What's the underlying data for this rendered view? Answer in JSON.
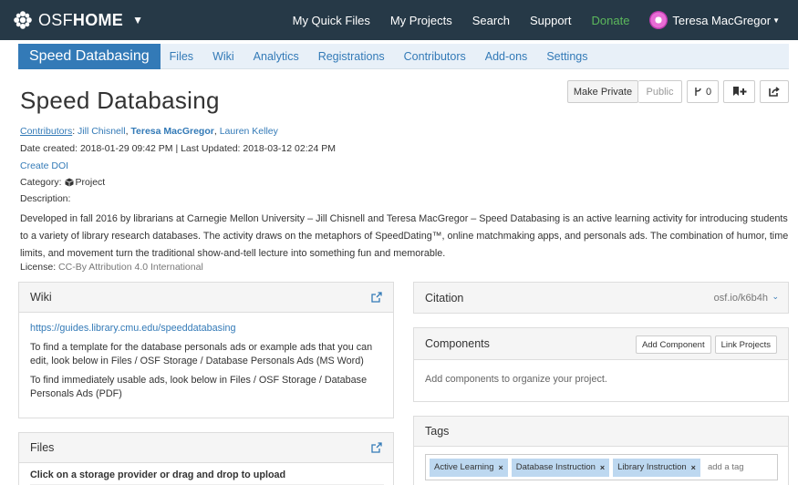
{
  "navbar": {
    "brand_osf": "OSF",
    "brand_home": "HOME",
    "links": [
      "My Quick Files",
      "My Projects",
      "Search",
      "Support",
      "Donate"
    ],
    "user_name": "Teresa MacGregor"
  },
  "project_nav": {
    "active": "Speed Databasing",
    "items": [
      "Files",
      "Wiki",
      "Analytics",
      "Registrations",
      "Contributors",
      "Add-ons",
      "Settings"
    ]
  },
  "project": {
    "title": "Speed Databasing",
    "buttons": {
      "make_private": "Make Private",
      "public": "Public",
      "fork_count": "0"
    },
    "contributors_label": "Contributors",
    "contributors": [
      "Jill Chisnell",
      "Teresa MacGregor",
      "Lauren Kelley"
    ],
    "dates": "Date created: 2018-01-29 09:42 PM | Last Updated: 2018-03-12 02:24 PM",
    "create_doi": "Create DOI",
    "category_label": "Category:",
    "category": "Project",
    "description_label": "Description:",
    "description": "Developed in fall 2016 by librarians at Carnegie Mellon University – Jill Chisnell and Teresa MacGregor – Speed Databasing is an active learning activity for introducing students to a variety of library research databases. The activity draws on the metaphors of SpeedDating™, online matchmaking apps, and personals ads. The combination of humor, time limits, and movement turn the traditional show-and-tell lecture into something fun and memorable.",
    "license_label": "License:",
    "license": "CC-By Attribution 4.0 International"
  },
  "wiki": {
    "title": "Wiki",
    "link": "https://guides.library.cmu.edu/speeddatabasing",
    "p1": "To find a template for the database personals ads or example ads that you can edit, look below in Files / OSF Storage / Database Personals Ads (MS Word)",
    "p2": "To find immediately usable ads, look below in Files / OSF Storage / Database Personals Ads (PDF)"
  },
  "files": {
    "title": "Files",
    "instruction": "Click on a storage provider or drag and drop to upload"
  },
  "citation": {
    "title": "Citation",
    "id": "osf.io/k6b4h"
  },
  "components": {
    "title": "Components",
    "add_button": "Add Component",
    "link_button": "Link Projects",
    "empty": "Add components to organize your project."
  },
  "tags": {
    "title": "Tags",
    "items": [
      "Active Learning",
      "Database Instruction",
      "Library Instruction"
    ],
    "placeholder": "add a tag"
  },
  "colors": {
    "navbar": "#263947",
    "accent": "#337ab7",
    "donate": "#5cb85c",
    "tag": "#bdd8f0"
  }
}
